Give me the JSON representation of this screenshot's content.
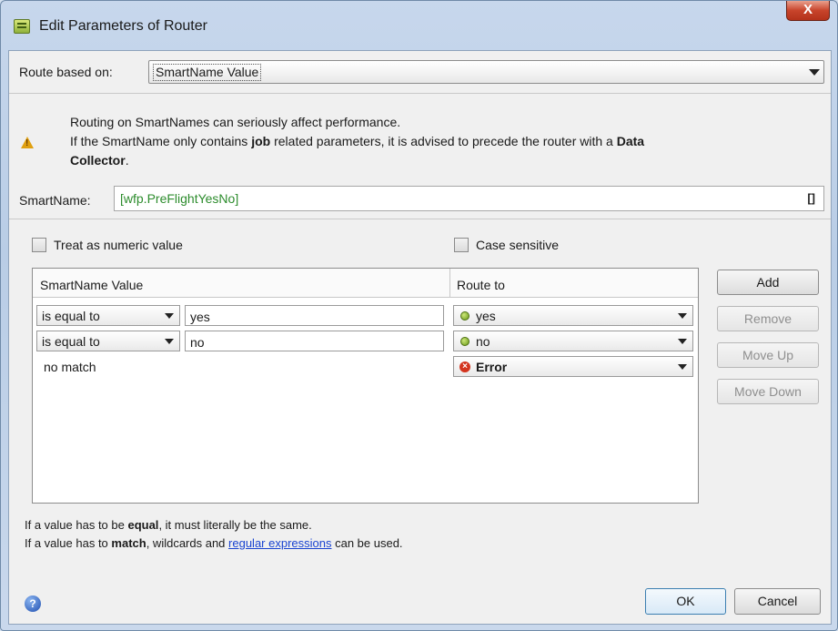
{
  "window": {
    "title": "Edit Parameters of Router",
    "close_label": "X"
  },
  "route": {
    "label": "Route based on:",
    "selected": "SmartName Value"
  },
  "warning": {
    "line1": "Routing on SmartNames can seriously affect performance.",
    "line2_pre": "If the SmartName only contains ",
    "line2_bold": "job",
    "line2_mid": " related parameters, it is advised to precede the router with a ",
    "line2_bold2": "Data",
    "line3_bold": "Collector",
    "line3_post": "."
  },
  "smartname": {
    "label": "SmartName:",
    "value": "[wfp.PreFlightYesNo]",
    "picker": "[]"
  },
  "options": {
    "numeric_label": "Treat as numeric value",
    "numeric_checked": false,
    "case_label": "Case sensitive",
    "case_checked": false
  },
  "table": {
    "col_value": "SmartName Value",
    "col_route": "Route to",
    "rows": [
      {
        "operator": "is equal to",
        "value": "yes",
        "route": "yes",
        "status": "ok"
      },
      {
        "operator": "is equal to",
        "value": "no",
        "route": "no",
        "status": "ok"
      }
    ],
    "nomatch": {
      "label": "no match",
      "route": "Error",
      "status": "error"
    }
  },
  "buttons": {
    "add": "Add",
    "remove": "Remove",
    "move_up": "Move Up",
    "move_down": "Move Down",
    "ok": "OK",
    "cancel": "Cancel"
  },
  "notes": {
    "line1_pre": "If a value has to be ",
    "line1_bold": "equal",
    "line1_post": ", it must literally be the same.",
    "line2_pre": "If a value has to ",
    "line2_bold": "match",
    "line2_mid": ", wildcards and ",
    "line2_link": "regular expressions",
    "line2_post": " can be used."
  },
  "help_glyph": "?",
  "icons": {
    "title": "router-app-icon",
    "warning": "warning-icon",
    "help": "help-icon",
    "ok_status": "green-dot-icon",
    "error_status": "error-icon"
  },
  "colors": {
    "accent": "#3c7fb1",
    "smartname_text": "#2c8c2c",
    "link": "#1a44d1",
    "error": "#d3341e",
    "ok": "#6a9a18"
  }
}
